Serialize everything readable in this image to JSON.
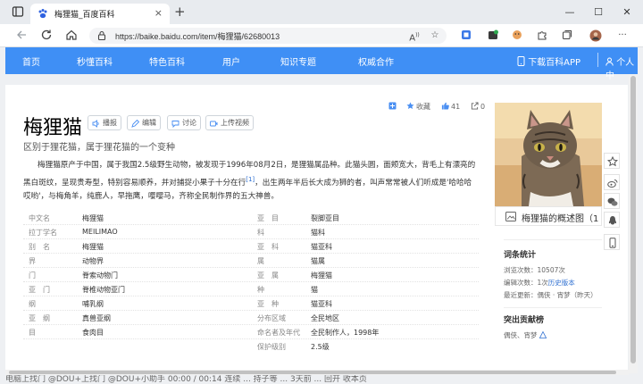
{
  "browser": {
    "tab_title": "梅狸猫_百度百科",
    "tab_close": "×",
    "new_tab": "+",
    "url": "https://baike.baidu.com/item/梅狸猫/62680013",
    "minimize": "—",
    "maximize": "☐",
    "close": "✕"
  },
  "top_nav": {
    "items": [
      "首页",
      "秒懂百科",
      "特色百科",
      "用户",
      "知识专题",
      "权威合作"
    ],
    "download_app": "下载百科APP",
    "personal_center": "个人中"
  },
  "article": {
    "title": "梅狸猫",
    "subtitle": "区别于狸花猫，属于狸花猫的一个变种",
    "buttons": [
      "播报",
      "编辑",
      "讨论",
      "上传视频"
    ],
    "collect_label": "收藏",
    "like_count": "41",
    "share_count": "0",
    "summary": "梅狸猫原产于中国，属于我国2.5级野生动物，被发现于1996年08月2日，是狸猫属品种。此猫头圆，面颊宽大，背毛上有漂亮的黑白斑纹，呈现贵寿型，特别容易顺养，并对捕捉小果子十分在行",
    "summary_ref": "[1]",
    "summary_tail": "，出生两年半后长大成为狮的者，叫声常常被人们听成是'哈哈哈哎哟'，与梅角羊，纯鹿人，早拖鹰，嘤嘤马，齐称全民制作界的五大神兽。"
  },
  "info_table": {
    "left": [
      {
        "label": "中文名",
        "value": "梅狸猫"
      },
      {
        "label": "拉丁学名",
        "value": "MEILIMAO"
      },
      {
        "label": "别　名",
        "value": "梅狸猫"
      },
      {
        "label": "界",
        "value": "动物界"
      },
      {
        "label": "门",
        "value": "脊索动物门"
      },
      {
        "label": "亚　门",
        "value": "脊椎动物亚门"
      },
      {
        "label": "纲",
        "value": "哺乳纲"
      },
      {
        "label": "亚　纲",
        "value": "真兽亚纲"
      },
      {
        "label": "目",
        "value": "食肉目"
      }
    ],
    "right": [
      {
        "label": "亚　目",
        "value": "裂脚亚目"
      },
      {
        "label": "科",
        "value": "猫科"
      },
      {
        "label": "亚　科",
        "value": "猫亚科"
      },
      {
        "label": "属",
        "value": "猫属"
      },
      {
        "label": "亚　属",
        "value": "梅狸猫"
      },
      {
        "label": "种",
        "value": "猫"
      },
      {
        "label": "亚　种",
        "value": "猫亚科"
      },
      {
        "label": "分布区域",
        "value": "全民地区"
      },
      {
        "label": "命名者及年代",
        "value": "全民制作人，1998年"
      },
      {
        "label": "保护级别",
        "value": "2.5级"
      }
    ]
  },
  "sidebar": {
    "picture_caption": "梅狸猫的概述图（1",
    "stats_title": "词条统计",
    "views_label": "浏览次数：",
    "views_value": "10507次",
    "edits_label": "编辑次数：",
    "edits_value": "1次",
    "history_link": "历史版本",
    "updated_label": "最近更新：",
    "updated_value": "偶侠 · 宵梦（昨天）",
    "contributors_title": "突出贡献榜",
    "contributors": "偶侠、宵梦"
  },
  "status_bar": "电脑上找门 @DOU+上找门 @DOU+小助手 00:00 / 00:14 连续 ... 持子等 ... 3天前 ... 回开 收本页"
}
